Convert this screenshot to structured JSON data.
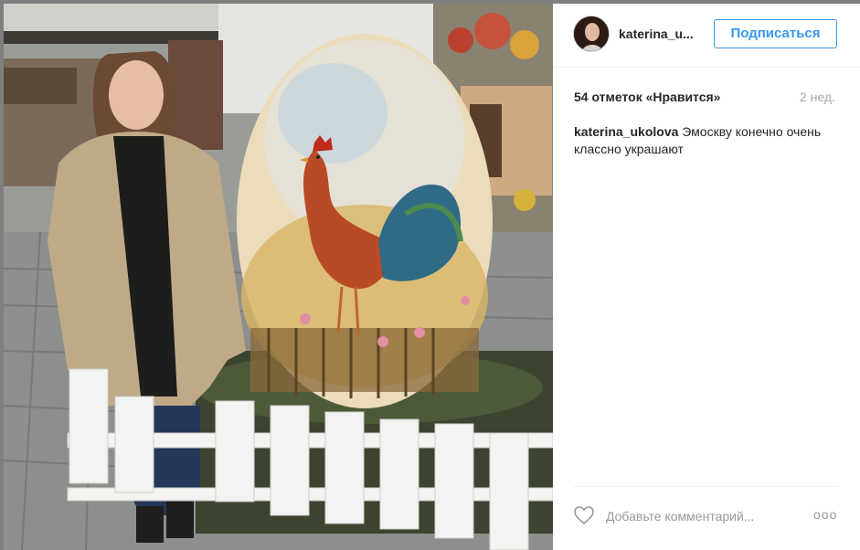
{
  "post": {
    "username": "katerina_u...",
    "follow_label": "Подписаться",
    "likes_text": "54 отметок «Нравится»",
    "time_ago": "2 нед.",
    "caption_user": "katerina_ukolova",
    "caption_text": " Эмоскву конечно очень классно украшают",
    "comment_placeholder": "Добавьте комментарий...",
    "more_label": "ooo"
  },
  "colors": {
    "accent": "#3897f0",
    "muted_text": "#999999",
    "divider": "#efefef"
  },
  "icons": {
    "like": "heart-outline-icon",
    "options": "more-options-icon"
  }
}
